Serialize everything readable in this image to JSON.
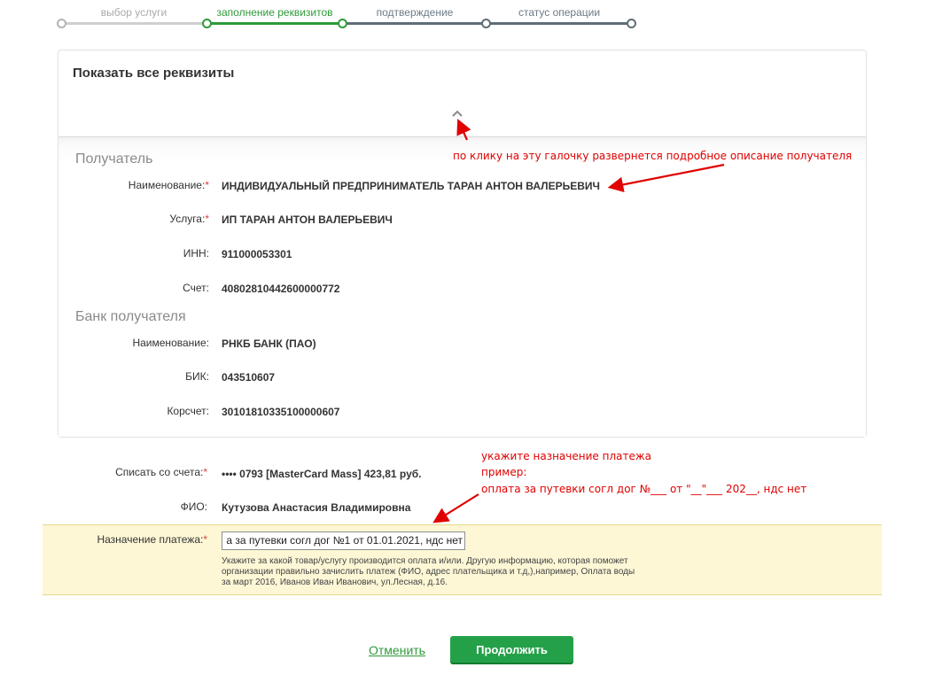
{
  "steps": [
    {
      "label": "выбор услуги",
      "state": "done"
    },
    {
      "label": "заполнение реквизитов",
      "state": "active"
    },
    {
      "label": "подтверждение",
      "state": "todo"
    },
    {
      "label": "статус операции",
      "state": "todo"
    }
  ],
  "colors": {
    "accent": "#2e9a3a",
    "button": "#24a148",
    "required": "#e23b3b",
    "annotation": "#e00000",
    "highlight": "#fdf7d6"
  },
  "details": {
    "title": "Показать все реквизиты",
    "toggle_icon": "chevron-up-icon",
    "recipient": {
      "section_title": "Получатель",
      "rows": [
        {
          "label": "Наименование:",
          "required": "*",
          "value": "ИНДИВИДУАЛЬНЫЙ ПРЕДПРИНИМАТЕЛЬ ТАРАН АНТОН ВАЛЕРЬЕВИЧ"
        },
        {
          "label": "Услуга:",
          "required": "*",
          "value": "ИП ТАРАН АНТОН ВАЛЕРЬЕВИЧ"
        },
        {
          "label": "ИНН:",
          "required": "",
          "value": "911000053301"
        },
        {
          "label": "Счет:",
          "required": "",
          "value": "40802810442600000772"
        }
      ]
    },
    "bank": {
      "section_title": "Банк получателя",
      "rows": [
        {
          "label": "Наименование:",
          "value": "РНКБ БАНК (ПАО)"
        },
        {
          "label": "БИК:",
          "value": "043510607"
        },
        {
          "label": "Корсчет:",
          "value": "30101810335100000607"
        }
      ]
    }
  },
  "form": {
    "account": {
      "label": "Списать со счета:",
      "required": "*",
      "value": "•••• 0793  [MasterCard Mass] 423,81   руб."
    },
    "fio": {
      "label": "ФИО:",
      "value": "Кутузова Анастасия Владимировна"
    },
    "purpose": {
      "label": "Назначение платежа:",
      "required": "*",
      "value": "а за путевки согл дог №1 от 01.01.2021, ндс нет",
      "hint": "Укажите за какой товар/услугу производится оплата и/или. Другую информацию, которая поможет организации правильно зачислить платеж (ФИО, адрес плательщика и т.д,),например, Оплата воды за март 2016, Иванов Иван Иванович, ул.Лесная, д.16."
    }
  },
  "actions": {
    "cancel_label": "Отменить",
    "continue_label": "Продолжить"
  },
  "annotations": {
    "toggle_note": "по клику на эту галочку развернется подробное описание получателя",
    "purpose_note_line1": "укажите назначение платежа",
    "purpose_note_line2": "пример:",
    "purpose_note_line3": "оплата за путевки согл дог №___ от \"__\"___ 202__, ндс нет"
  }
}
